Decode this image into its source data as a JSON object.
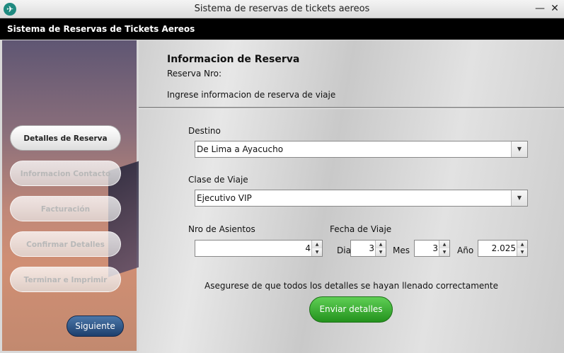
{
  "window": {
    "title": "Sistema de reservas de tickets aereos",
    "minimize_glyph": "—",
    "close_glyph": "✕",
    "app_icon": "airplane-icon",
    "app_icon_glyph": "✈"
  },
  "header": {
    "title": "Sistema de Reservas de Tickets Aereos"
  },
  "sidebar": {
    "steps": [
      {
        "label": "Detalles de Reserva",
        "state": "active"
      },
      {
        "label": "Informacion Contacto",
        "state": "disabled"
      },
      {
        "label": "Facturación",
        "state": "disabled"
      },
      {
        "label": "Confirmar Detalles",
        "state": "disabled"
      },
      {
        "label": "Terminar e Imprimir",
        "state": "disabled"
      }
    ],
    "next_label": "Siguiente"
  },
  "main": {
    "section_title": "Informacion de Reserva",
    "reservation_label": "Reserva Nro:",
    "instructions": "Ingrese informacion de reserva de viaje",
    "destino": {
      "label": "Destino",
      "value": "De Lima a Ayacucho"
    },
    "clase": {
      "label": "Clase de Viaje",
      "value": "Ejecutivo VIP"
    },
    "asientos": {
      "label": "Nro de Asientos",
      "value": "4"
    },
    "fecha": {
      "label": "Fecha de Viaje",
      "dia_label": "Dia",
      "dia_value": "3",
      "mes_label": "Mes",
      "mes_value": "3",
      "anio_label": "Año",
      "anio_value": "2.025"
    },
    "note": "Asegurese de que todos los detalles se hayan llenado correctamente",
    "submit_label": "Enviar detalles"
  },
  "colors": {
    "header_bg": "#000000",
    "submit_green": "#2fa32a",
    "next_blue": "#2a4f82"
  }
}
